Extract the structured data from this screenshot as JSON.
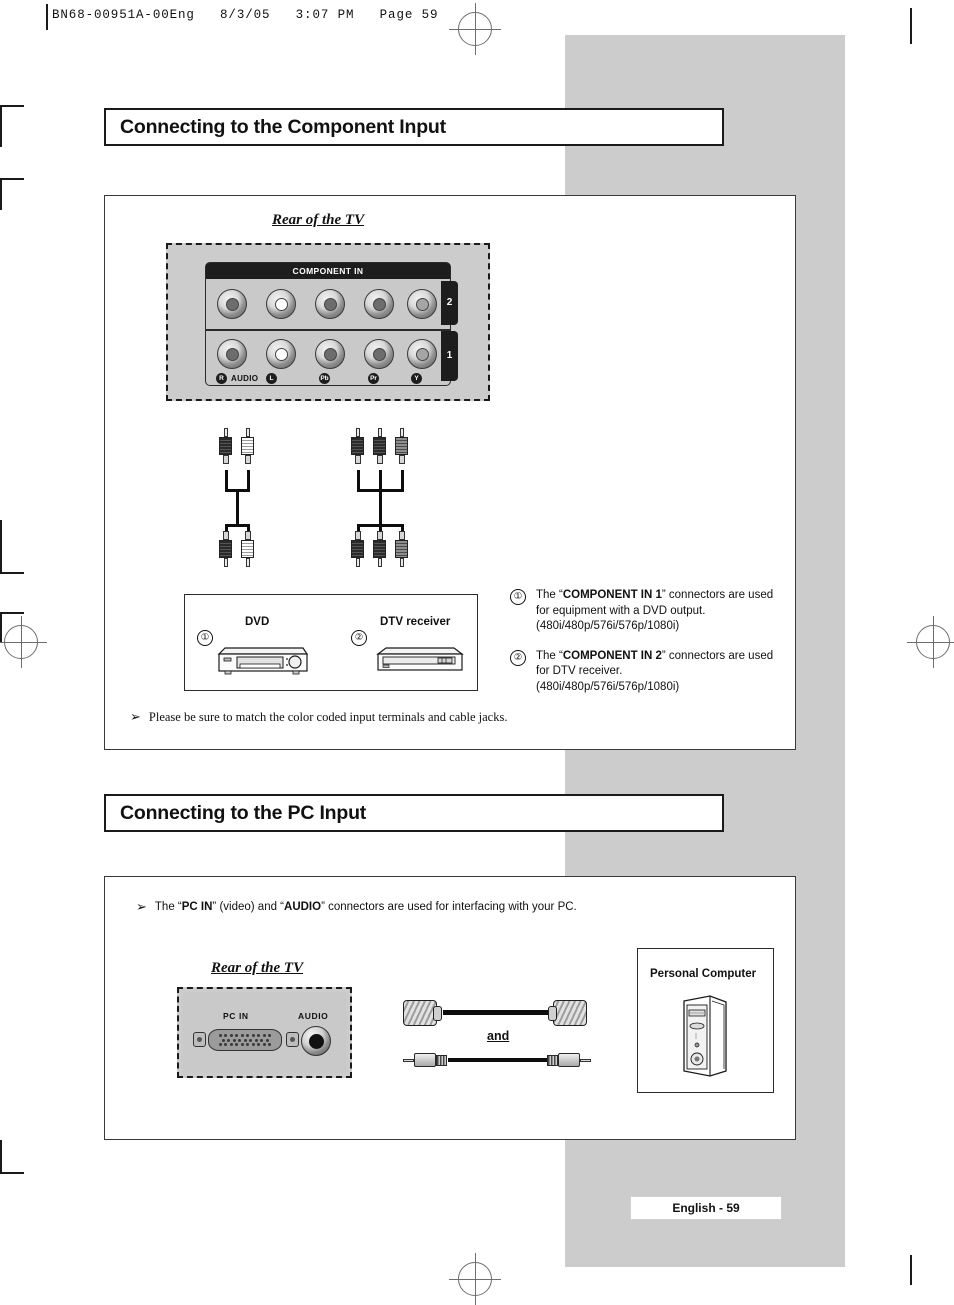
{
  "print": {
    "header": "BN68-00951A-00Eng   8/3/05   3:07 PM   Page 59",
    "footer": "English - 59"
  },
  "sections": [
    {
      "title": "Connecting to the Component Input",
      "rear_label": "Rear of the TV",
      "panel": {
        "header": "COMPONENT IN",
        "row_numbers": [
          "2",
          "1"
        ],
        "jack_labels": {
          "audio_r": "R",
          "audio_text": "AUDIO",
          "audio_l": "L",
          "pb": "Pb",
          "pr": "Pr",
          "y": "Y"
        }
      },
      "devices": [
        {
          "number": "①",
          "name": "DVD"
        },
        {
          "number": "②",
          "name": "DTV receiver"
        }
      ],
      "explanations": [
        {
          "number": "①",
          "prefix": "The “",
          "bold": "COMPONENT IN 1",
          "suffix": "” connectors are used for equipment with a DVD output.",
          "formats": "(480i/480p/576i/576p/1080i)"
        },
        {
          "number": "②",
          "prefix": "The “",
          "bold": "COMPONENT IN 2",
          "suffix": "” connectors are used for DTV receiver.",
          "formats": "(480i/480p/576i/576p/1080i)"
        }
      ],
      "note": {
        "arrow": "➢",
        "text": "Please be sure to match the color coded input terminals and cable jacks."
      }
    },
    {
      "title": "Connecting to the PC Input",
      "rear_label": "Rear of the TV",
      "note": {
        "arrow": "➢",
        "part1": "The “",
        "bold1": "PC IN",
        "part2": "” (video) and “",
        "bold2": "AUDIO",
        "part3": "” connectors are used for interfacing with your PC."
      },
      "panel": {
        "pc_in_label": "PC IN",
        "audio_label": "AUDIO"
      },
      "cables": {
        "conjunction": "and"
      },
      "computer": {
        "title": "Personal Computer"
      }
    }
  ],
  "colors": {
    "grey_panel": "#cccccc",
    "panel_face": "#c9c9c9",
    "ink": "#111111"
  }
}
